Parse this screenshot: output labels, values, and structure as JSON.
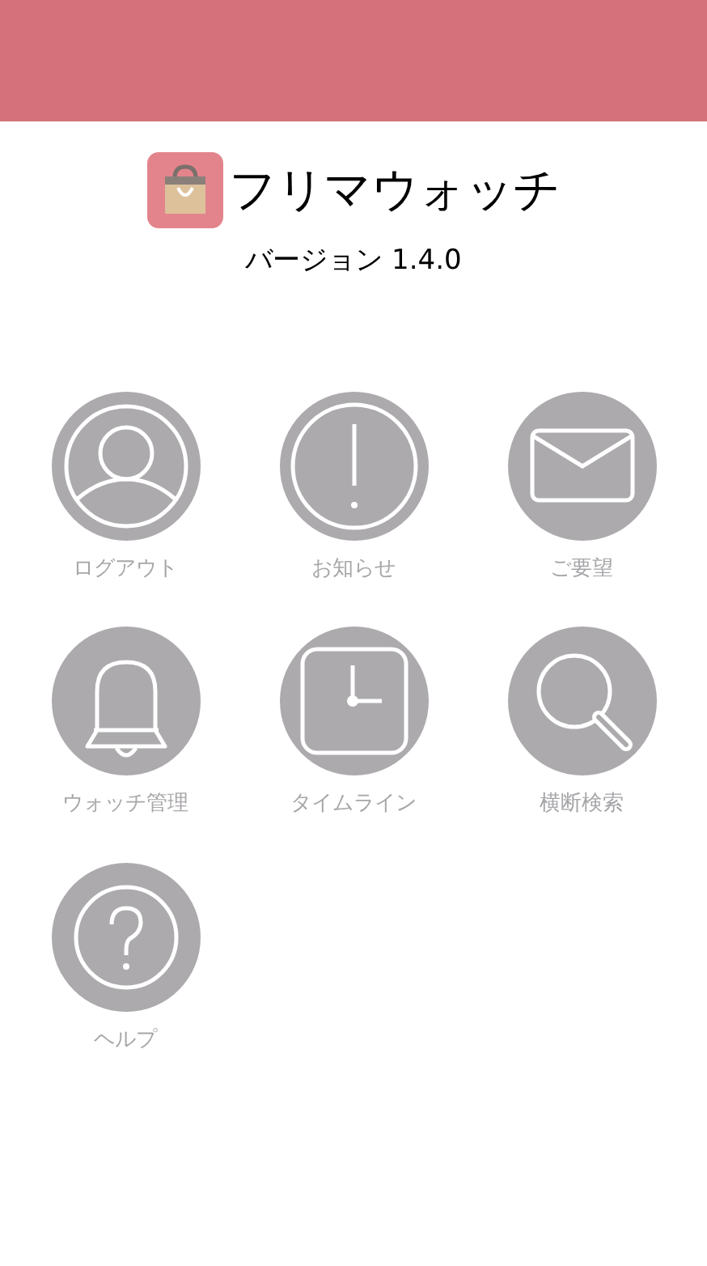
{
  "app": {
    "name": "フリマウォッチ",
    "version": "バージョン 1.4.0"
  },
  "menu": [
    {
      "kind": "user",
      "label": "ログアウト"
    },
    {
      "kind": "alert",
      "label": "お知らせ"
    },
    {
      "kind": "mail",
      "label": "ご要望"
    },
    {
      "kind": "bell",
      "label": "ウォッチ管理"
    },
    {
      "kind": "clock",
      "label": "タイムライン"
    },
    {
      "kind": "search",
      "label": "横断検索"
    },
    {
      "kind": "help",
      "label": "ヘルプ"
    }
  ]
}
